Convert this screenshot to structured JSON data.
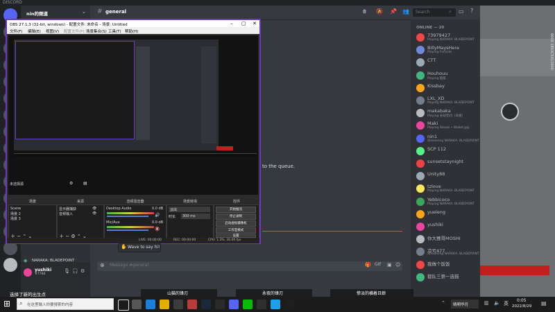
{
  "titlebar": {
    "label": "DISCORD"
  },
  "server": {
    "name": "nin的频道"
  },
  "channel": {
    "name": "general",
    "search_placeholder": "Search"
  },
  "members_header": "ONLINE — 20",
  "members": [
    {
      "name": "73979427",
      "activity": "Playing NARAKA: BLADEPOINT",
      "color": "#f04747"
    },
    {
      "name": "BillyMaysHere",
      "activity": "Playing Fortnite",
      "color": "#7289da"
    },
    {
      "name": "CTT",
      "activity": "",
      "color": "#99aab5"
    },
    {
      "name": "Houhouu",
      "activity": "Playing 超级",
      "color": "#43b581"
    },
    {
      "name": "Kissbay",
      "activity": "",
      "color": "#faa61a"
    },
    {
      "name": "LXL_XD",
      "activity": "Playing NARAKA: BLADEPOINT",
      "color": "#747f8d"
    },
    {
      "name": "makabaka",
      "activity": "Playing 永劫无间（日服）",
      "color": "#b9bbbe"
    },
    {
      "name": "Maki",
      "activity": "Playing Steam • Wallet.jpg",
      "color": "#eb459e"
    },
    {
      "name": "nin1",
      "activity": "Streaming NARAKA: BLADEPOINT",
      "color": "#5865f2"
    },
    {
      "name": "SCP 112",
      "activity": "",
      "color": "#57f287"
    },
    {
      "name": "sunsetstaynight",
      "activity": "",
      "color": "#ed4245"
    },
    {
      "name": "Unity88",
      "activity": "",
      "color": "#99aab5"
    },
    {
      "name": "tzlove",
      "activity": "Playing NARAKA: BLADEPOINT",
      "color": "#fee75c"
    },
    {
      "name": "Yebbicoco",
      "activity": "Playing NARAKA: BLADEPOINT",
      "color": "#3ba55c"
    },
    {
      "name": "yueleng",
      "activity": "",
      "color": "#faa61a"
    },
    {
      "name": "yushiki",
      "activity": "",
      "color": "#eb459e"
    },
    {
      "name": "你大赛哥MOSHI",
      "activity": "",
      "color": "#b9bbbe"
    },
    {
      "name": "凉亏477",
      "activity": "Streaming NARAKA: BLADEPOINT",
      "color": "#747f8d"
    },
    {
      "name": "我做个饭饭",
      "activity": "",
      "color": "#f04747"
    },
    {
      "name": "都队三第一选猫",
      "activity": "",
      "color": "#43b581"
    }
  ],
  "chat": {
    "queue_text": "to the queue.",
    "composer_placeholder": "Message #general"
  },
  "user_panel": {
    "game": "NARAKA: BLADEPOINT",
    "username": "yushiki",
    "tag": "#7788"
  },
  "obs": {
    "title": "OBS 27.1.3 (32-bit, windows) - 配置文件: 未命名 - 场景: Untitled",
    "menu": [
      "文件(F)",
      "编辑(E)",
      "视图(V)",
      "配置文件(P)",
      "场景集合(S)",
      "工具(T)",
      "帮助(H)"
    ],
    "scene_label": "未选择源",
    "docks": {
      "scenes": {
        "title": "场景",
        "items": [
          "Scene",
          "场景 2",
          "场景 3"
        ]
      },
      "sources": {
        "title": "来源",
        "items": [
          "显示器捕获",
          "音频输入"
        ]
      },
      "mixer": {
        "title": "音频混音器",
        "items": [
          "Desktop Audio",
          "Mic/Aux"
        ],
        "values": [
          "0.0 dB",
          "0.0 dB"
        ]
      },
      "transitions": {
        "title": "场景转场",
        "type": "淡出",
        "duration_label": "时长",
        "duration": "300 ms"
      },
      "controls": {
        "title": "控件",
        "buttons": [
          "开始推流",
          "停止录制",
          "启动虚拟摄像机",
          "工作室模式",
          "设置",
          "退出"
        ]
      }
    },
    "status": {
      "live": "LIVE: 00:00:00",
      "rec": "REC: 00:00:00",
      "cpu": "CPU: 1.3%, 30.00 fps"
    }
  },
  "notification": {
    "text": "Wave to say hi!"
  },
  "event_toast": "选择了新的出生点",
  "taskbar": {
    "search_placeholder": "在这里输入你要搜索的内容",
    "toasts": [
      "山猫的锋刃",
      "永夜的锋刃",
      "惨淡的横着且娘"
    ],
    "tray_lang": "英",
    "time": "0:05",
    "date": "2022/8/29",
    "tray_status": "晴明华月"
  },
  "right_panel": {
    "side_text": "8000 1803C5012000"
  },
  "colors": {
    "obs_border": "#6a3bbd",
    "discord_bg": "#36393f",
    "sidebar": "#2f3136"
  }
}
